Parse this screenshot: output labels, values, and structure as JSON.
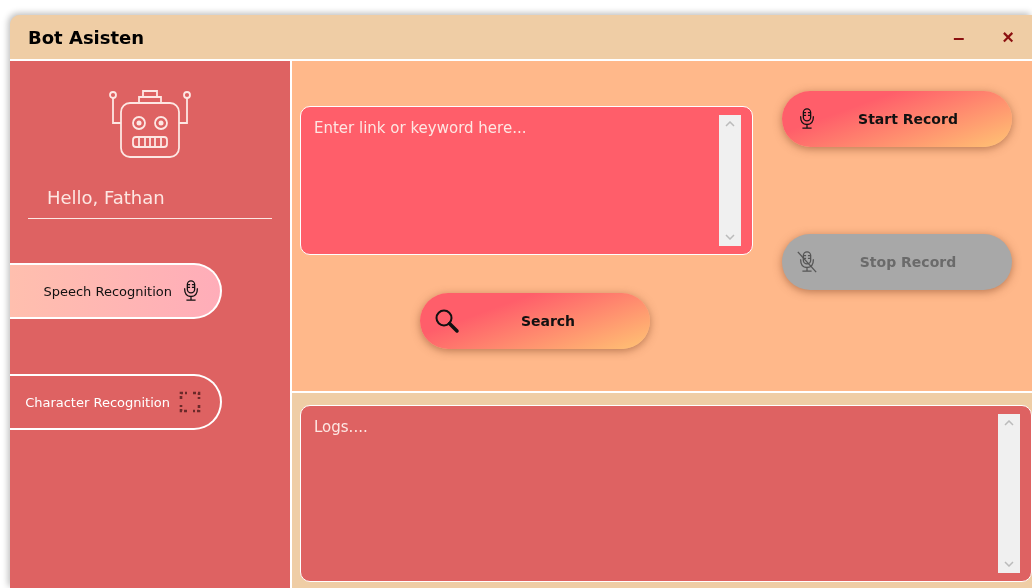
{
  "window": {
    "title": "Bot Asisten",
    "minimize": "–",
    "close": "×"
  },
  "sidebar": {
    "greeting": "Hello,  Fathan",
    "items": [
      {
        "label": "Speech Recognition",
        "kind": "speech",
        "selected": true
      },
      {
        "label": "Character Recognition",
        "kind": "character",
        "selected": false
      }
    ]
  },
  "search": {
    "placeholder": "Enter link or keyword here...",
    "button": "Search"
  },
  "record_buttons": [
    {
      "label": "Start Record",
      "disabled": false
    },
    {
      "label": "Stop Record",
      "disabled": true
    }
  ],
  "logs": {
    "placeholder": "Logs...."
  }
}
